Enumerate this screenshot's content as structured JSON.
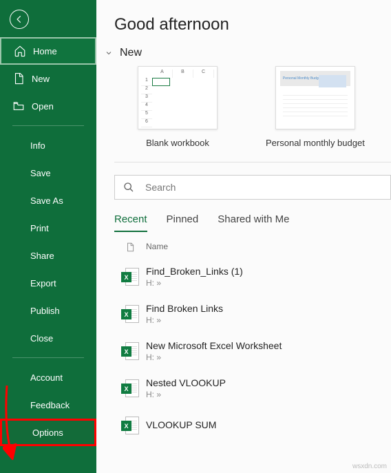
{
  "sidebar": {
    "home": "Home",
    "new": "New",
    "open": "Open",
    "info": "Info",
    "save": "Save",
    "saveAs": "Save As",
    "print": "Print",
    "share": "Share",
    "export": "Export",
    "publish": "Publish",
    "close": "Close",
    "account": "Account",
    "feedback": "Feedback",
    "options": "Options"
  },
  "main": {
    "greeting": "Good afternoon",
    "newSection": "New",
    "templates": {
      "blank": "Blank workbook",
      "budget": "Personal monthly budget"
    },
    "search": {
      "placeholder": "Search"
    },
    "tabs": {
      "recent": "Recent",
      "pinned": "Pinned",
      "shared": "Shared with Me"
    },
    "listHeader": {
      "name": "Name"
    },
    "files": [
      {
        "name": "Find_Broken_Links (1)",
        "path": "H: »"
      },
      {
        "name": "Find  Broken  Links",
        "path": "H: »"
      },
      {
        "name": "New Microsoft Excel Worksheet",
        "path": "H: »"
      },
      {
        "name": "Nested VLOOKUP",
        "path": "H: »"
      },
      {
        "name": "VLOOKUP SUM",
        "path": ""
      }
    ]
  },
  "watermark": "wsxdn.com"
}
